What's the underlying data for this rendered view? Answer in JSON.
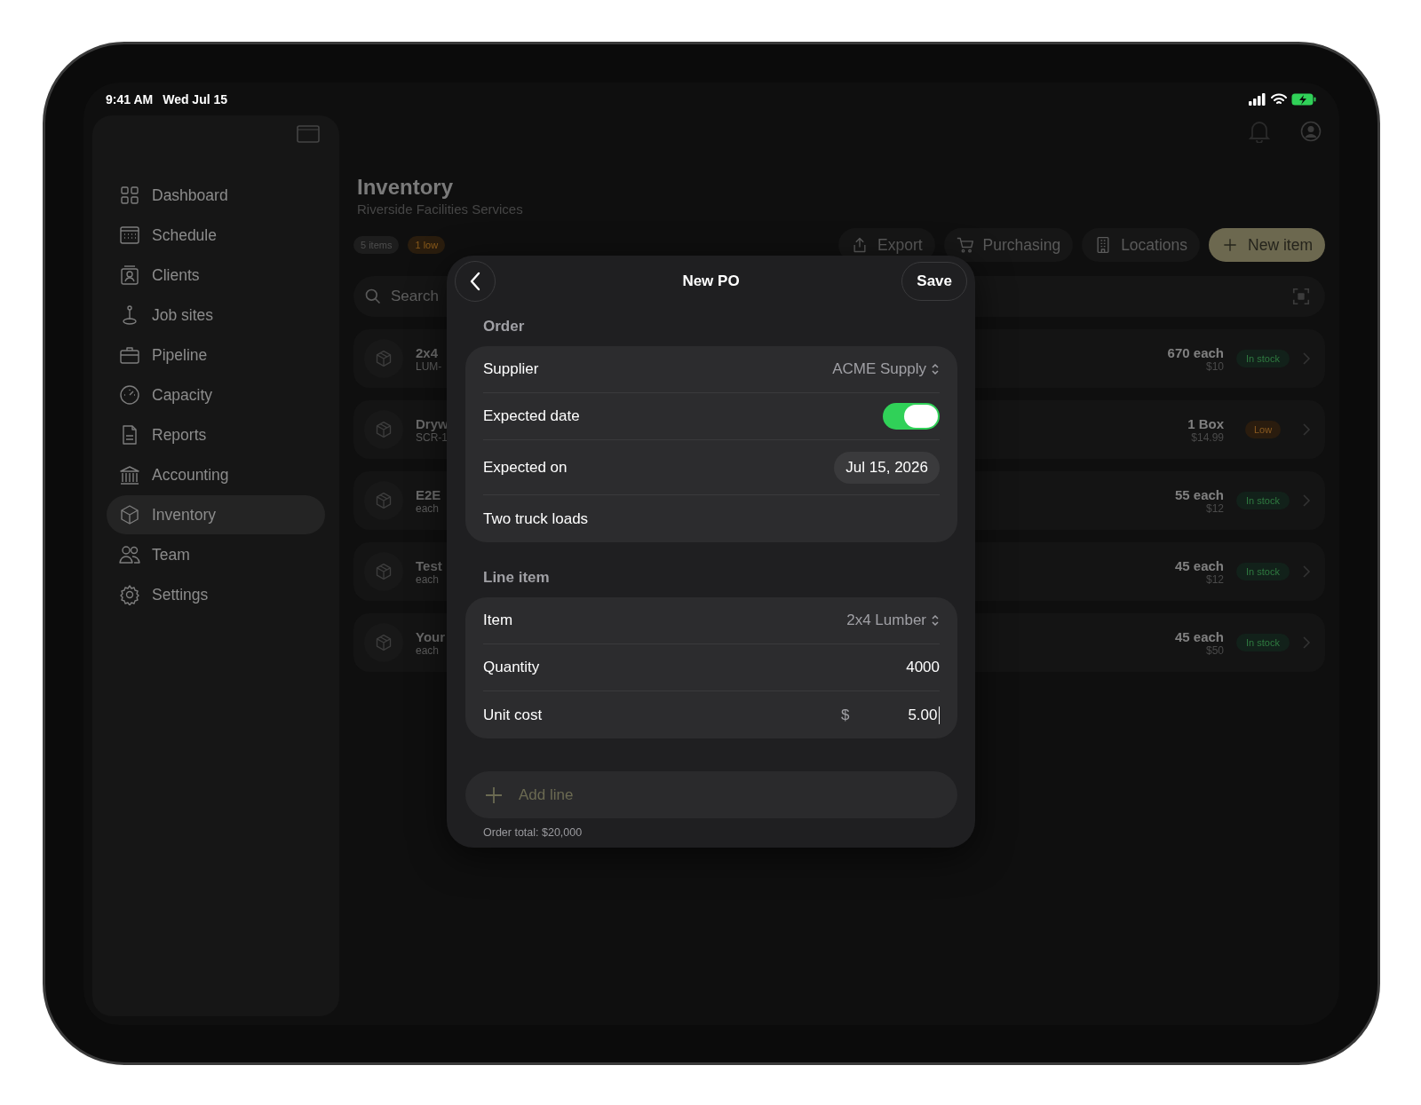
{
  "status_bar": {
    "time": "9:41 AM",
    "date": "Wed Jul 15"
  },
  "sidebar": {
    "items": [
      {
        "label": "Dashboard",
        "selected": false
      },
      {
        "label": "Schedule",
        "selected": false
      },
      {
        "label": "Clients",
        "selected": false
      },
      {
        "label": "Job sites",
        "selected": false
      },
      {
        "label": "Pipeline",
        "selected": false
      },
      {
        "label": "Capacity",
        "selected": false
      },
      {
        "label": "Reports",
        "selected": false
      },
      {
        "label": "Accounting",
        "selected": false
      },
      {
        "label": "Inventory",
        "selected": true
      },
      {
        "label": "Team",
        "selected": false
      },
      {
        "label": "Settings",
        "selected": false
      }
    ]
  },
  "header": {
    "title": "Inventory",
    "subtitle": "Riverside Facilities Services"
  },
  "chips": [
    {
      "label": "5 items",
      "kind": "neutral"
    },
    {
      "label": "1 low",
      "kind": "warning"
    }
  ],
  "actions": [
    {
      "label": "Export",
      "kind": "plain"
    },
    {
      "label": "Purchasing",
      "kind": "plain"
    },
    {
      "label": "Locations",
      "kind": "plain"
    },
    {
      "label": "New item",
      "kind": "primary"
    }
  ],
  "search": {
    "placeholder": "Search"
  },
  "rows": [
    {
      "title": "2x4",
      "subtitle": "LUM-",
      "quantity": "670 each",
      "price": "$10",
      "status": "In stock",
      "kind": "ok"
    },
    {
      "title": "Dryw",
      "subtitle": "SCR-1",
      "quantity": "1 Box",
      "price": "$14.99",
      "status": "Low",
      "kind": "low"
    },
    {
      "title": "E2E",
      "subtitle": "each",
      "quantity": "55 each",
      "price": "$12",
      "status": "In stock",
      "kind": "ok"
    },
    {
      "title": "Test",
      "subtitle": "each",
      "quantity": "45 each",
      "price": "$12",
      "status": "In stock",
      "kind": "ok"
    },
    {
      "title": "Your",
      "subtitle": "each",
      "quantity": "45 each",
      "price": "$50",
      "status": "In stock",
      "kind": "ok"
    }
  ],
  "modal": {
    "title": "New PO",
    "save": "Save",
    "sections": [
      {
        "heading": "Order",
        "rows": [
          {
            "kind": "picker",
            "label": "Supplier",
            "value": "ACME Supply"
          },
          {
            "kind": "toggle",
            "label": "Expected date",
            "on": true
          },
          {
            "kind": "date",
            "label": "Expected on",
            "value": "Jul 15, 2026"
          },
          {
            "kind": "text",
            "value": "Two truck loads"
          }
        ]
      },
      {
        "heading": "Line item",
        "rows": [
          {
            "kind": "picker",
            "label": "Item",
            "value": "2x4 Lumber"
          },
          {
            "kind": "number",
            "label": "Quantity",
            "value": "4000"
          },
          {
            "kind": "currency",
            "label": "Unit cost",
            "prefix": "$",
            "value": "5.00"
          }
        ]
      }
    ],
    "add_line": "Add line",
    "total": "Order total: $20,000"
  }
}
